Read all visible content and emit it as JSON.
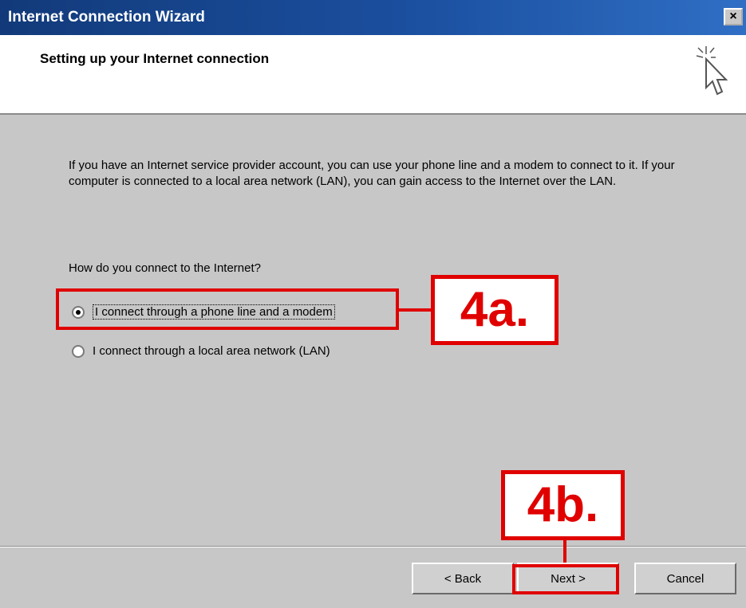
{
  "window": {
    "title": "Internet Connection Wizard",
    "close_label": "×"
  },
  "header": {
    "title": "Setting up your Internet connection",
    "icon": "wizard-cursor-icon"
  },
  "content": {
    "intro": "If you have an Internet service provider account, you can use your phone line and a modem to connect to it. If your computer is connected to a local area network (LAN), you can gain access to the Internet over the LAN.",
    "question": "How do you connect to the Internet?",
    "options": [
      {
        "label": "I connect through a phone line and a modem",
        "selected": true
      },
      {
        "label": "I connect through a local area network (LAN)",
        "selected": false
      }
    ]
  },
  "annotations": {
    "step_4a": "4a.",
    "step_4b": "4b.",
    "color": "#e00000"
  },
  "buttons": {
    "back": "< Back",
    "next": "Next >",
    "cancel": "Cancel"
  }
}
